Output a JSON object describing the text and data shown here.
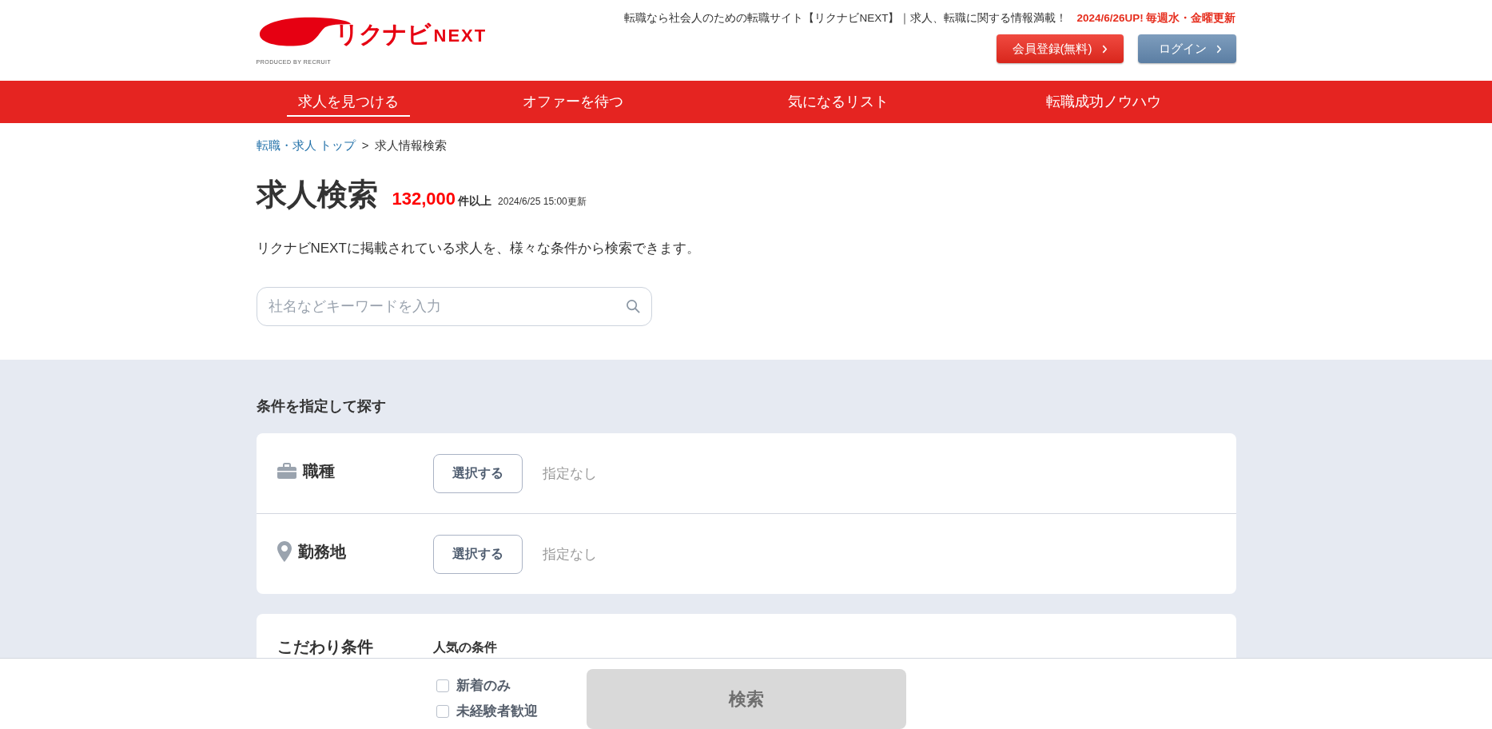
{
  "header": {
    "logo": {
      "main": "リクナビ",
      "sub": "NEXT",
      "credit": "PRODUCED BY RECRUIT"
    },
    "tagline": "転職なら社会人のための転職サイト【リクナビNEXT】｜求人、転職に関する情報満載！",
    "update_note": "2024/6/26UP! 毎週水・金曜更新",
    "buttons": [
      {
        "label": "会員登録(無料)",
        "kind": "register"
      },
      {
        "label": "ログイン",
        "kind": "login"
      }
    ]
  },
  "nav": [
    {
      "label": "求人を見つける",
      "selected": true
    },
    {
      "label": "オファーを待つ",
      "selected": false
    },
    {
      "label": "気になるリスト",
      "selected": false
    },
    {
      "label": "転職成功ノウハウ",
      "selected": false
    }
  ],
  "breadcrumb": {
    "link": "転職・求人 トップ",
    "separator": ">",
    "current": "求人情報検索"
  },
  "title": "求人検索",
  "count": "132,000",
  "count_suffix": "件以上",
  "updated": "2024/6/25 15:00更新",
  "description": "リクナビNEXTに掲載されている求人を、様々な条件から検索できます。",
  "search": {
    "placeholder": "社名などキーワードを入力"
  },
  "section_title": "条件を指定して探す",
  "criteria": [
    {
      "label": "職種",
      "kind": "job",
      "button": "選択する",
      "value": "指定なし"
    },
    {
      "label": "勤務地",
      "kind": "location",
      "button": "選択する",
      "value": "指定なし"
    }
  ],
  "extra": {
    "label": "こだわり条件",
    "group": "人気の条件"
  },
  "footer": {
    "checkboxes": [
      {
        "label": "新着のみ",
        "checked": false
      },
      {
        "label": "未経験者歓迎",
        "checked": false
      }
    ],
    "search_button": {
      "label": "検索",
      "disabled": true
    }
  }
}
